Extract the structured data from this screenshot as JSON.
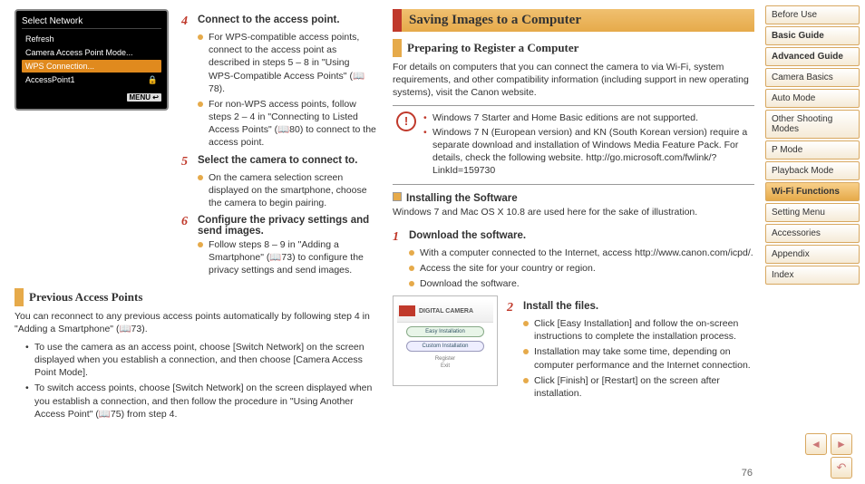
{
  "page_number": "76",
  "camera_screen": {
    "title": "Select Network",
    "rows": [
      {
        "label": "Refresh",
        "selected": false
      },
      {
        "label": "Camera Access Point Mode...",
        "selected": false
      },
      {
        "label": "WPS Connection...",
        "selected": true
      },
      {
        "label": "AccessPoint1",
        "selected": false,
        "lock": "🔒"
      }
    ],
    "menu": "MENU ↩"
  },
  "left": {
    "step4": {
      "num": "4",
      "title": "Connect to the access point.",
      "bullets": [
        "For WPS-compatible access points, connect to the access point as described in steps 5 – 8 in \"Using WPS-Compatible Access Points\" (📖78).",
        "For non-WPS access points, follow steps 2 – 4 in \"Connecting to Listed Access Points\" (📖80) to connect to the access point."
      ]
    },
    "step5": {
      "num": "5",
      "title": "Select the camera to connect to.",
      "bullets": [
        "On the camera selection screen displayed on the smartphone, choose the camera to begin pairing."
      ]
    },
    "step6": {
      "num": "6",
      "title": "Configure the privacy settings and send images.",
      "bullets": [
        "Follow steps 8 – 9 in \"Adding a Smartphone\" (📖73) to configure the privacy settings and send images."
      ]
    },
    "prev_heading": "Previous Access Points",
    "prev_para": "You can reconnect to any previous access points automatically by following step 4 in \"Adding a Smartphone\" (📖73).",
    "prev_bullets": [
      "To use the camera as an access point, choose [Switch Network] on the screen displayed when you establish a connection, and then choose [Camera Access Point Mode].",
      "To switch access points, choose [Switch Network] on the screen displayed when you establish a connection, and then follow the procedure in \"Using Another Access Point\" (📖75) from step 4."
    ]
  },
  "right": {
    "h1": "Saving Images to a Computer",
    "h2": "Preparing to Register a Computer",
    "para1": "For details on computers that you can connect the camera to via Wi-Fi, system requirements, and other compatibility information (including support in new operating systems), visit the Canon website.",
    "note": [
      "Windows 7 Starter and Home Basic editions are not supported.",
      "Windows 7 N (European version) and KN (South Korean version) require a separate download and installation of Windows Media Feature Pack. For details, check the following website. http://go.microsoft.com/fwlink/?LinkId=159730"
    ],
    "h3": "Installing the Software",
    "para2": "Windows 7 and Mac OS X 10.8 are used here for the sake of illustration.",
    "step1": {
      "num": "1",
      "title": "Download the software.",
      "bullets": [
        "With a computer connected to the Internet, access http://www.canon.com/icpd/.",
        "Access the site for your country or region.",
        "Download the software."
      ]
    },
    "step2": {
      "num": "2",
      "title": "Install the files.",
      "bullets": [
        "Click [Easy Installation] and follow the on-screen instructions to complete the installation process.",
        "Installation may take some time, depending on computer performance and the Internet connection.",
        "Click [Finish] or [Restart] on the screen after installation."
      ]
    },
    "sw": {
      "brand": "Canon",
      "title": "DIGITAL CAMERA",
      "btn1": "Easy Installation",
      "btn2": "Custom Installation",
      "btn3": "Register",
      "btn4": "Exit"
    }
  },
  "sidebar": [
    {
      "label": "Before Use"
    },
    {
      "label": "Basic Guide",
      "bold": true
    },
    {
      "label": "Advanced Guide",
      "bold": true
    },
    {
      "label": "Camera Basics"
    },
    {
      "label": "Auto Mode"
    },
    {
      "label": "Other Shooting Modes"
    },
    {
      "label": "P Mode"
    },
    {
      "label": "Playback Mode"
    },
    {
      "label": "Wi-Fi Functions",
      "active": true
    },
    {
      "label": "Setting Menu"
    },
    {
      "label": "Accessories"
    },
    {
      "label": "Appendix"
    },
    {
      "label": "Index"
    }
  ]
}
